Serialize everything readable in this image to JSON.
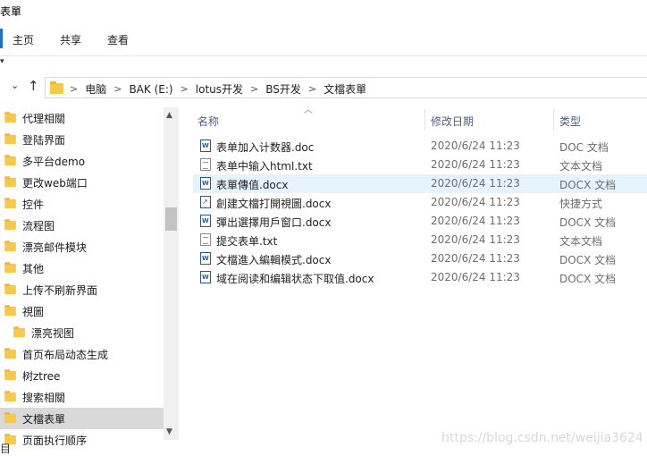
{
  "window": {
    "title": "表單"
  },
  "ribbon": {
    "tabs": [
      "主页",
      "共享",
      "查看"
    ]
  },
  "address": {
    "crumbs": [
      "电脑",
      "BAK (E:)",
      "lotus开发",
      "BS开发",
      "文檔表單"
    ]
  },
  "sidebar": {
    "items": [
      {
        "label": "代理相關"
      },
      {
        "label": "登陆界面"
      },
      {
        "label": "多平台demo"
      },
      {
        "label": "更改web端口"
      },
      {
        "label": "控件"
      },
      {
        "label": "流程图"
      },
      {
        "label": "漂亮邮件模块"
      },
      {
        "label": "其他"
      },
      {
        "label": "上传不刷新界面"
      },
      {
        "label": "視圖"
      },
      {
        "label": "漂亮视图"
      },
      {
        "label": "首页布局动态生成"
      },
      {
        "label": "树ztree"
      },
      {
        "label": "搜索相關"
      },
      {
        "label": "文檔表單"
      },
      {
        "label": "页面执行顺序"
      }
    ],
    "selected_index": 14
  },
  "columns": {
    "name": "名称",
    "date": "修改日期",
    "type": "类型"
  },
  "files": [
    {
      "name": "表单加入计数器.doc",
      "date": "2020/6/24 11:23",
      "type": "DOC 文档",
      "icon": "word-doc-icon"
    },
    {
      "name": "表单中输入html.txt",
      "date": "2020/6/24 11:23",
      "type": "文本文档",
      "icon": "text-file-icon"
    },
    {
      "name": "表單傳值.docx",
      "date": "2020/6/24 11:23",
      "type": "DOCX 文档",
      "icon": "word-doc-icon",
      "selected": true
    },
    {
      "name": "創建文檔打開視圖.docx",
      "date": "2020/6/24 11:23",
      "type": "快捷方式",
      "icon": "shortcut-icon"
    },
    {
      "name": "彈出選擇用戶窗口.docx",
      "date": "2020/6/24 11:23",
      "type": "DOCX 文档",
      "icon": "word-doc-icon"
    },
    {
      "name": "提交表单.txt",
      "date": "2020/6/24 11:23",
      "type": "文本文档",
      "icon": "text-file-icon"
    },
    {
      "name": "文檔進入編輯模式.docx",
      "date": "2020/6/24 11:23",
      "type": "DOCX 文档",
      "icon": "word-doc-icon"
    },
    {
      "name": "域在阅读和编辑状态下取值.docx",
      "date": "2020/6/24 11:23",
      "type": "DOCX 文档",
      "icon": "word-doc-icon"
    }
  ],
  "status": {
    "fragment": "目"
  },
  "watermark": "https://blog.csdn.net/weijia3624"
}
